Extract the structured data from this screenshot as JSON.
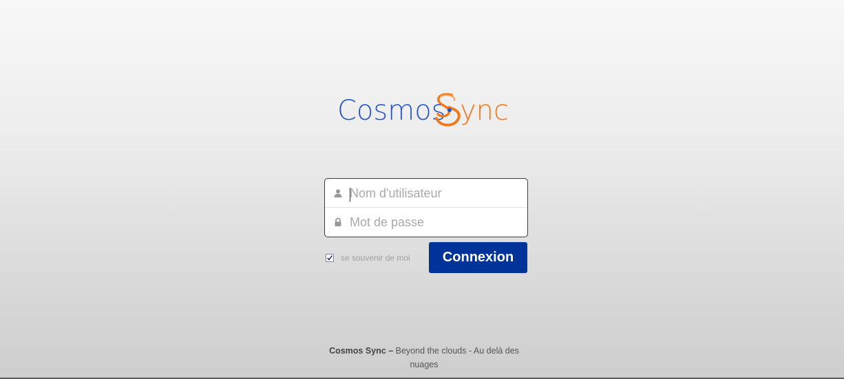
{
  "logo": {
    "text_left": "Cosmos",
    "text_right": "ync",
    "left_color": "#2855c6",
    "right_color": "#f07a1e"
  },
  "login": {
    "username_placeholder": "Nom d'utilisateur",
    "password_placeholder": "Mot de passe",
    "username_icon": "user-icon",
    "password_icon": "lock-icon"
  },
  "remember": {
    "label": "se souvenir de moi",
    "checked": true
  },
  "submit": {
    "label": "Connexion",
    "color": "#003399"
  },
  "footer": {
    "brand": "Cosmos Sync –",
    "tagline": " Beyond the clouds - Au delà des nuages"
  }
}
